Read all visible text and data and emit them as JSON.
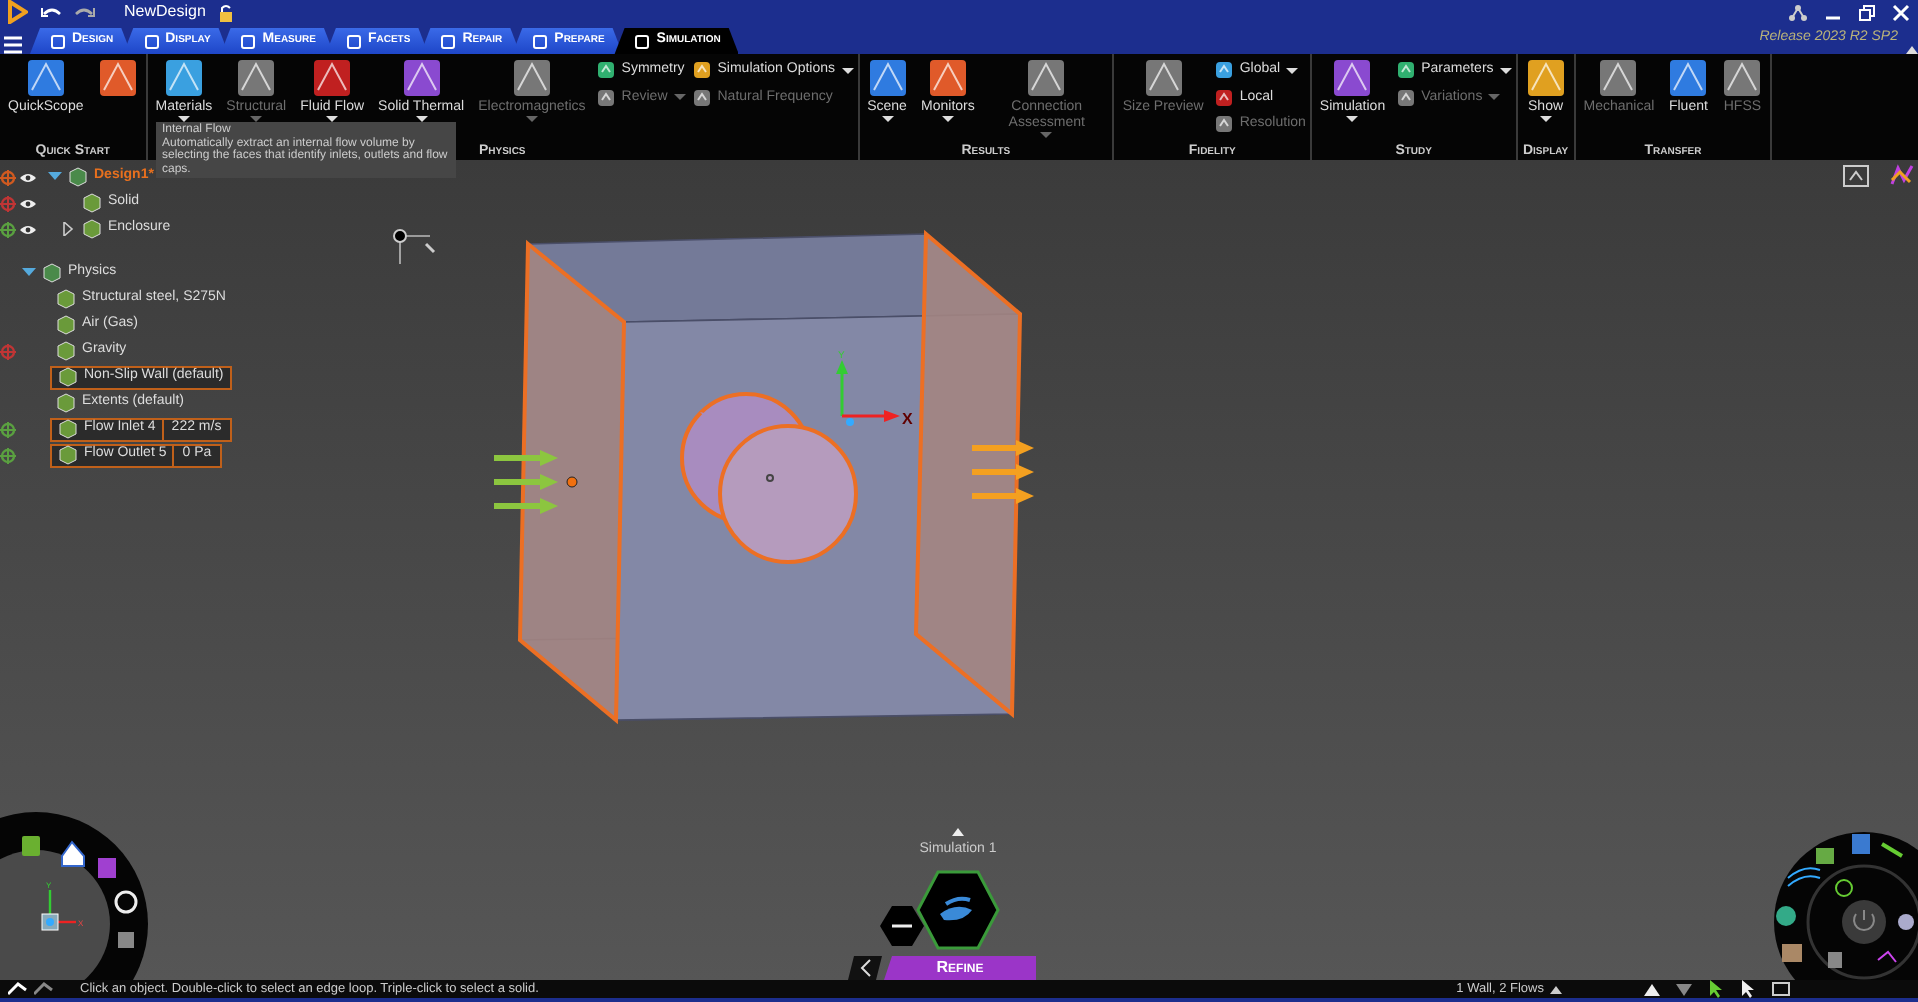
{
  "window": {
    "title": "NewDesign",
    "release": "Release 2023 R2 SP2"
  },
  "tabs": [
    {
      "label": "Design",
      "selected": false
    },
    {
      "label": "Display",
      "selected": false
    },
    {
      "label": "Measure",
      "selected": false
    },
    {
      "label": "Facets",
      "selected": false
    },
    {
      "label": "Repair",
      "selected": false
    },
    {
      "label": "Prepare",
      "selected": false
    },
    {
      "label": "Simulation",
      "selected": true
    }
  ],
  "ribbon": [
    {
      "group": "Quick Start",
      "items": [
        {
          "kind": "large",
          "label": "QuickScope",
          "disabled": false,
          "dropdown": false
        },
        {
          "kind": "large",
          "disabled": false,
          "dropdown": false
        }
      ]
    },
    {
      "group": "Physics",
      "items": [
        {
          "kind": "large",
          "label": "Materials",
          "disabled": false,
          "dropdown": true
        },
        {
          "kind": "large",
          "label": "Structural",
          "disabled": true,
          "dropdown": true
        },
        {
          "kind": "large",
          "label": "Fluid Flow",
          "disabled": false,
          "dropdown": true
        },
        {
          "kind": "large",
          "label": "Solid Thermal",
          "disabled": false,
          "dropdown": true
        },
        {
          "kind": "large",
          "label": "Electromagnetics",
          "disabled": true,
          "dropdown": true
        },
        {
          "kind": "stack",
          "items": [
            {
              "label": "Symmetry",
              "disabled": false,
              "dropdown": false
            },
            {
              "label": "Review",
              "disabled": true,
              "dropdown": true
            }
          ]
        },
        {
          "kind": "stack",
          "items": [
            {
              "label": "Simulation Options",
              "disabled": false,
              "dropdown": true
            },
            {
              "label": "Natural Frequency",
              "disabled": true,
              "dropdown": false
            }
          ]
        }
      ]
    },
    {
      "group": "Results",
      "items": [
        {
          "kind": "large",
          "label": "Scene",
          "disabled": false,
          "dropdown": true
        },
        {
          "kind": "large",
          "label": "Monitors",
          "disabled": false,
          "dropdown": true
        },
        {
          "kind": "large",
          "label": "Connection Assessment",
          "disabled": true,
          "dropdown": true
        }
      ]
    },
    {
      "group": "Fidelity",
      "items": [
        {
          "kind": "large",
          "label": "Size Preview",
          "disabled": true,
          "dropdown": false
        },
        {
          "kind": "stack",
          "items": [
            {
              "label": "Global",
              "disabled": false,
              "dropdown": true
            },
            {
              "label": "Local",
              "disabled": false,
              "dropdown": false
            },
            {
              "label": "Resolution",
              "disabled": true,
              "dropdown": false
            }
          ]
        }
      ]
    },
    {
      "group": "Study",
      "items": [
        {
          "kind": "large",
          "label": "Simulation",
          "disabled": false,
          "dropdown": true
        },
        {
          "kind": "stack",
          "items": [
            {
              "label": "Parameters",
              "disabled": false,
              "dropdown": true
            },
            {
              "label": "Variations",
              "disabled": true,
              "dropdown": true
            }
          ]
        }
      ]
    },
    {
      "group": "Display",
      "items": [
        {
          "kind": "large",
          "label": "Show",
          "disabled": false,
          "dropdown": true
        }
      ]
    },
    {
      "group": "Transfer",
      "items": [
        {
          "kind": "large",
          "label": "Mechanical",
          "disabled": true,
          "dropdown": false
        },
        {
          "kind": "large",
          "label": "Fluent",
          "disabled": false,
          "dropdown": false
        },
        {
          "kind": "large",
          "label": "HFSS",
          "disabled": true,
          "dropdown": false
        }
      ]
    }
  ],
  "tooltip": {
    "title": "Internal Flow",
    "text": "Automatically extract an internal flow volume by selecting the faces that identify inlets, outlets and flow caps."
  },
  "tree": [
    {
      "label": "Design1*",
      "active": true,
      "expanded": true,
      "visible": true,
      "color": "#d05a20",
      "selected": false,
      "children": [
        {
          "label": "Solid",
          "visible": true,
          "color": "#c03535",
          "selected": false
        },
        {
          "label": "Enclosure",
          "visible": true,
          "color": "#5aa040",
          "expanded": false,
          "selected": false
        }
      ]
    },
    {
      "label": "Physics",
      "active": false,
      "expanded": true,
      "selected": false,
      "children": [
        {
          "label": "Structural steel, S275N",
          "selected": false
        },
        {
          "label": "Air (Gas)",
          "selected": false
        },
        {
          "label": "Gravity",
          "color": "#c03535",
          "selected": false
        },
        {
          "label": "Non-Slip Wall (default)",
          "selected": true
        },
        {
          "label": "Extents (default)",
          "selected": false
        },
        {
          "label": "Flow Inlet 4",
          "value": "222 m/s",
          "color": "#5aa040",
          "selected": true
        },
        {
          "label": "Flow Outlet 5",
          "value": "0 Pa",
          "color": "#5aa040",
          "selected": true
        }
      ]
    }
  ],
  "viewport": {
    "axis_labels": [
      "X",
      "Y"
    ],
    "wheel_axis_labels": [
      "X",
      "Y"
    ]
  },
  "stage": {
    "caption": "Simulation 1",
    "mode": "Refine"
  },
  "status_bar": {
    "hint": "Click an object. Double-click to select an edge loop. Triple-click to select a solid.",
    "selection": "1 Wall, 2 Flows"
  }
}
